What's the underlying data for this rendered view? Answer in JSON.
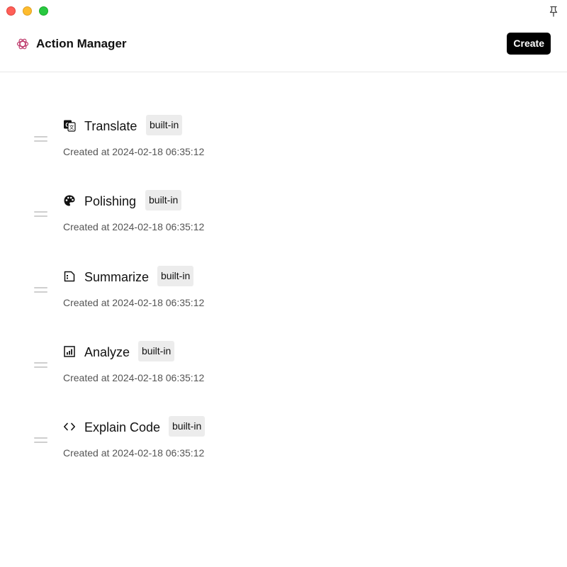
{
  "window": {
    "controls": [
      "close",
      "minimize",
      "maximize"
    ],
    "pin_icon": "pin-icon"
  },
  "header": {
    "logo_icon": "openai-logo-icon",
    "title": "Action Manager",
    "create_label": "Create"
  },
  "actions": [
    {
      "icon": "translate-icon",
      "name": "Translate",
      "badge": "built-in",
      "created": "Created at 2024-02-18 06:35:12"
    },
    {
      "icon": "palette-icon",
      "name": "Polishing",
      "badge": "built-in",
      "created": "Created at 2024-02-18 06:35:12"
    },
    {
      "icon": "document-icon",
      "name": "Summarize",
      "badge": "built-in",
      "created": "Created at 2024-02-18 06:35:12"
    },
    {
      "icon": "chart-icon",
      "name": "Analyze",
      "badge": "built-in",
      "created": "Created at 2024-02-18 06:35:12"
    },
    {
      "icon": "code-icon",
      "name": "Explain Code",
      "badge": "built-in",
      "created": "Created at 2024-02-18 06:35:12"
    }
  ],
  "colors": {
    "close": "#ff5f57",
    "minimize": "#febc2e",
    "maximize": "#28c840",
    "primary_button": "#000000",
    "badge_bg": "#ececec"
  }
}
